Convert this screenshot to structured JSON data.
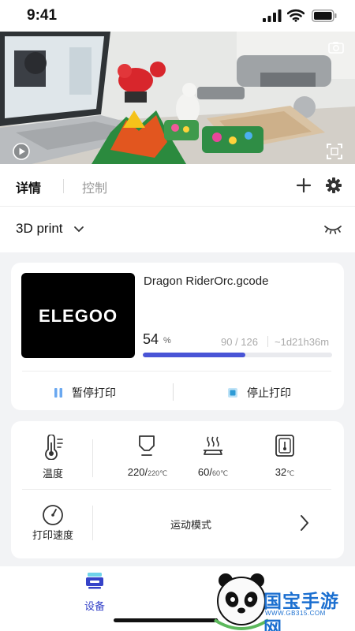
{
  "status_bar": {
    "time": "9:41"
  },
  "tabs": {
    "details": "详情",
    "control": "控制"
  },
  "printer": {
    "name": "3D print"
  },
  "job": {
    "brand_logo": "ELEGOO",
    "filename": "Dragon RiderOrc.gcode",
    "progress_percent": "54",
    "progress_unit": "%",
    "progress_fraction": 0.54,
    "layers": "90 / 126",
    "remaining": "~1d21h36m",
    "pause_label": "暂停打印",
    "stop_label": "停止打印"
  },
  "temperatures": {
    "temp_label": "温度",
    "nozzle_value": "220/",
    "nozzle_target": "220℃",
    "bed_value": "60/",
    "bed_target": "60℃",
    "chamber_value": "32",
    "chamber_unit": "℃"
  },
  "speed": {
    "label": "打印速度",
    "mode": "运动模式"
  },
  "bottom_nav": {
    "devices": "设备"
  },
  "watermark": {
    "text": "国宝手游网",
    "sub": "WWW.GB315.COM"
  },
  "colors": {
    "accent": "#4954d6",
    "tab_highlight": "#6fd3ea",
    "nav_active": "#3542c8"
  }
}
